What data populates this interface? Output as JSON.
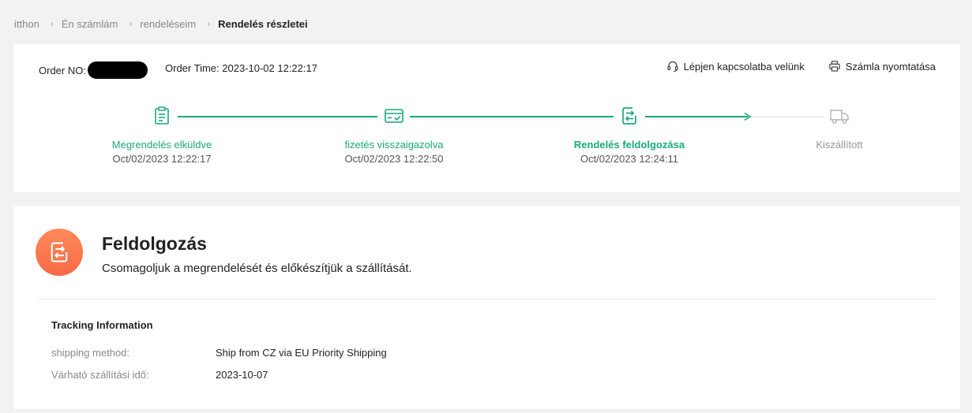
{
  "breadcrumb": [
    {
      "label": "itthon"
    },
    {
      "label": "Én számlám"
    },
    {
      "label": "rendeléseim"
    },
    {
      "label": "Rendelés részletei"
    }
  ],
  "order": {
    "no_label": "Order NO:",
    "time_label": "Order Time:",
    "time_value": "2023-10-02 12:22:17"
  },
  "actions": {
    "contact": "Lépjen kapcsolatba velünk",
    "print": "Számla nyomtatása"
  },
  "steps": [
    {
      "label": "Megrendelés elküldve",
      "time": "Oct/02/2023 12:22:17",
      "state": "done",
      "icon": "clipboard-icon"
    },
    {
      "label": "fizetés visszaigazolva",
      "time": "Oct/02/2023 12:22:50",
      "state": "done",
      "icon": "card-check-icon"
    },
    {
      "label": "Rendelés feldolgozása",
      "time": "Oct/02/2023 12:24:11",
      "state": "current",
      "icon": "processing-icon"
    },
    {
      "label": "Kiszállított",
      "time": "",
      "state": "pending",
      "icon": "truck-icon"
    }
  ],
  "status": {
    "title": "Feldolgozás",
    "description": "Csomagoljuk a megrendelését és előkészítjük a szállítását.",
    "icon": "processing-icon"
  },
  "tracking": {
    "title": "Tracking Information",
    "rows": [
      {
        "key": "shipping method:",
        "value": "Ship from CZ via EU Priority Shipping"
      },
      {
        "key": "Várható szállítási idő:",
        "value": "2023-10-07"
      }
    ]
  },
  "colors": {
    "accent": "#1aa97b",
    "pending": "#b5b5b5",
    "status_icon": "#f86a45"
  }
}
